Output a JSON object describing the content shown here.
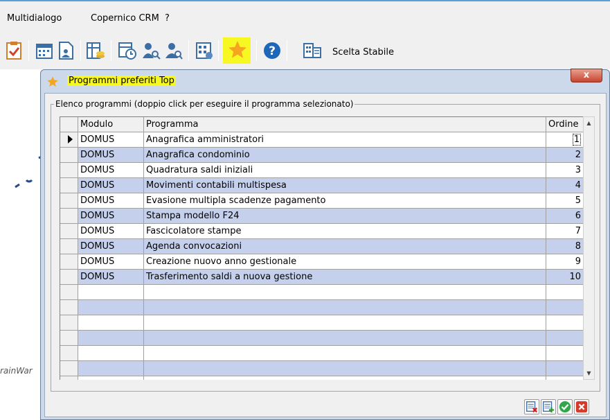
{
  "menubar": {
    "items": [
      "Multidialogo",
      "Copernico CRM",
      "?"
    ]
  },
  "toolbar": {
    "icons": [
      "checklist-icon",
      "calendar-icon",
      "document-user-icon",
      "table-coins-icon",
      "calendar-clock-icon",
      "user-search-icon",
      "users-search-icon",
      "grid-calendar-icon",
      "star-icon",
      "help-icon",
      "building-grid-icon"
    ],
    "scelta_label": "Scelta Stabile"
  },
  "background": {
    "watermark_text": "rainWar"
  },
  "dialog": {
    "title": "Programmi preferiti Top",
    "close_label": "x",
    "group_label": "Elenco programmi (doppio click per eseguire il programma selezionato)",
    "columns": [
      "Modulo",
      "Programma",
      "Ordine"
    ],
    "rows": [
      {
        "modulo": "DOMUS",
        "programma": "Anagrafica amministratori",
        "ordine": "1"
      },
      {
        "modulo": "DOMUS",
        "programma": "Anagrafica condominio",
        "ordine": "2"
      },
      {
        "modulo": "DOMUS",
        "programma": "Quadratura saldi iniziali",
        "ordine": "3"
      },
      {
        "modulo": "DOMUS",
        "programma": "Movimenti contabili multispesa",
        "ordine": "4"
      },
      {
        "modulo": "DOMUS",
        "programma": "Evasione multipla scadenze pagamento",
        "ordine": "5"
      },
      {
        "modulo": "DOMUS",
        "programma": "Stampa modello F24",
        "ordine": "6"
      },
      {
        "modulo": "DOMUS",
        "programma": "Fascicolatore stampe",
        "ordine": "7"
      },
      {
        "modulo": "DOMUS",
        "programma": "Agenda convocazioni",
        "ordine": "8"
      },
      {
        "modulo": "DOMUS",
        "programma": "Creazione nuovo anno gestionale",
        "ordine": "9"
      },
      {
        "modulo": "DOMUS",
        "programma": "Trasferimento saldi a nuova gestione",
        "ordine": "10"
      }
    ],
    "buttons": [
      "delete-row-icon",
      "add-row-icon",
      "confirm-icon",
      "cancel-icon"
    ]
  },
  "colors": {
    "row_alt": "#c4d0ec",
    "title_highlight": "#f7f722",
    "dialog_frame": "#cbd9ea",
    "close_button": "#c7452f"
  }
}
